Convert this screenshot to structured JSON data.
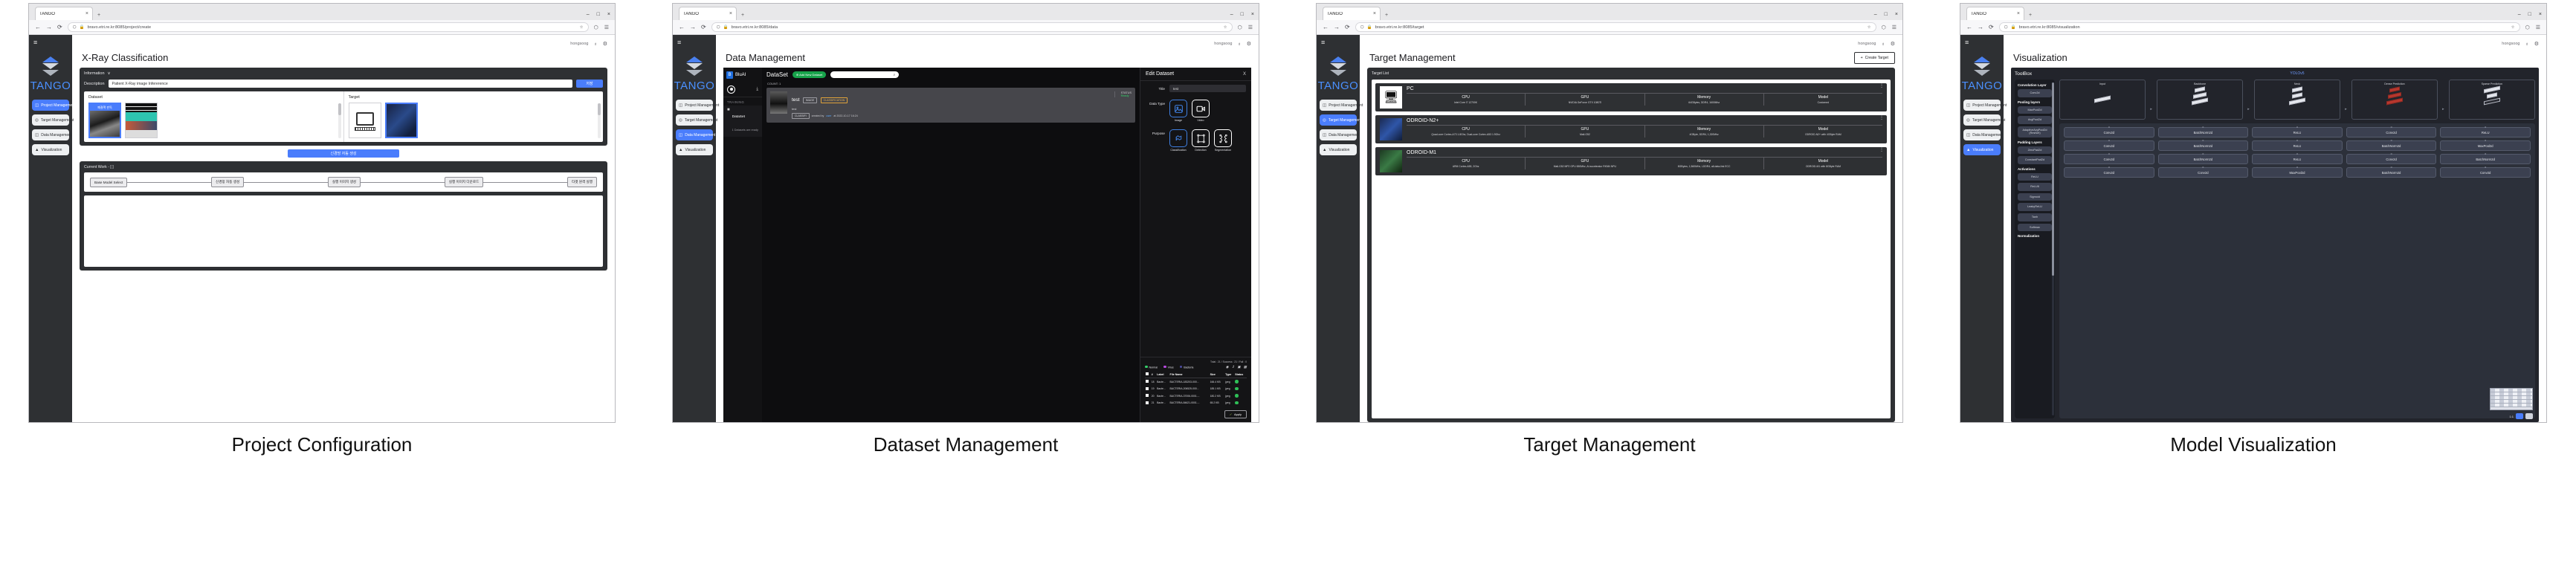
{
  "browser": {
    "tab_title": "TANGO",
    "tab_close": "×",
    "new_tab": "+",
    "minimize": "–",
    "maximize": "□",
    "close": "×",
    "back": "←",
    "forward": "→",
    "reload": "⟳",
    "shield_icon": "⬡",
    "lock_icon": "🔒",
    "star_icon": "☆",
    "pocket_icon": "⬡",
    "menu_icon": "☰"
  },
  "sidebar": {
    "hamburger": "≡",
    "logo_text": "TANGO",
    "items": [
      {
        "label": "Project Management",
        "icon": "project-icon"
      },
      {
        "label": "Target Management",
        "icon": "target-icon"
      },
      {
        "label": "Data Management",
        "icon": "database-icon"
      },
      {
        "label": "Visualization",
        "icon": "chart-icon"
      }
    ]
  },
  "topbar": {
    "user": "hongsoog",
    "bell": "♁",
    "gear": "⚙"
  },
  "panels": [
    {
      "caption": "Project Configuration",
      "url": "bravo.etri.re.kr:8085/project/create",
      "active_nav": 0,
      "page_title": "X-Ray Classification",
      "information": {
        "header": "Information",
        "chevron": "∨",
        "description_label": "Description",
        "description_value": "Patient X-Ray image Infererence",
        "save_label": "저장"
      },
      "dataset": {
        "label": "Dataset",
        "selected_caption": "폐결핵 판독"
      },
      "target": {
        "label": "Target"
      },
      "generate_button": "신경망 자동 생성",
      "current_work": {
        "title": "Current Work -  [    ]",
        "steps": [
          "Base Model Select",
          "신경망 자동 생성",
          "실행 이미지 생성",
          "실행 이미지 다운로드",
          "타겟 원격 실행"
        ]
      }
    },
    {
      "caption": "Dataset Management",
      "url": "bravo.etri.re.kr:8085/data",
      "active_nav": 2,
      "page_title": "Data Management",
      "bluai": {
        "brand": "BluAI",
        "brand_mark": "B",
        "upload_icon": "⤓",
        "section_label": "TRAINING",
        "item_title": "DataSet",
        "item_subtitle": "1 Datasets are ready"
      },
      "dataset_panel": {
        "title": "DataSet",
        "add_button": "⊕ Add New Dataset",
        "search_icon": "⌕",
        "count_label": "COUNT: 1",
        "card": {
          "name": "test",
          "tags": [
            "IMAGE",
            "CLASSIFICATION"
          ],
          "subtitle": "test",
          "status_tag": "CLASSIFI",
          "created_by_label": "created by",
          "created_by": "user",
          "created_at": "at 2022-10-17 16:24",
          "status_col": "STATUS",
          "status_value": "Ready"
        }
      },
      "edit_dataset": {
        "title": "Edit Dataset",
        "close": "X",
        "title_label": "Title",
        "title_value": "test",
        "data_type_label": "Data Type",
        "data_types": [
          {
            "name": "Image",
            "icon": "image-icon"
          },
          {
            "name": "Video",
            "icon": "video-icon"
          }
        ],
        "purpose_label": "Purpose",
        "purposes": [
          {
            "name": "Classification",
            "icon": "classification-icon"
          },
          {
            "name": "Detection",
            "icon": "detection-icon"
          },
          {
            "name": "Segmentation",
            "icon": "segmentation-icon"
          }
        ],
        "totals": "Total : 21  /  Success : 21  /  Fail : 0",
        "legend": [
          {
            "label": "Normal",
            "color": "#35d06a"
          },
          {
            "label": "Virus",
            "color": "#b84ae0"
          },
          {
            "label": "Bacteria",
            "color": "#4a4aa0"
          }
        ],
        "tool_icons": [
          "eye-icon",
          "upload-icon",
          "columns-icon",
          "trash-icon"
        ],
        "columns": [
          "",
          "#",
          "Label",
          "File Name",
          "Size",
          "Type",
          "Status"
        ],
        "rows": [
          {
            "num": "18",
            "label": "Bacte...",
            "file": "BACTERIA-183203-000...",
            "size": "166.4 KB",
            "type": "jpeg"
          },
          {
            "num": "19",
            "label": "Bacte...",
            "file": "BACTERIA-206525-000...",
            "size": "185.1 KB",
            "type": "jpeg"
          },
          {
            "num": "20",
            "label": "Bacte...",
            "file": "BACTERIA-37006-0001....",
            "size": "180.2 KB",
            "type": "jpeg"
          },
          {
            "num": "21",
            "label": "Bacte...",
            "file": "BACTERIA-84621-0001....",
            "size": "65.2 KB",
            "type": "jpeg"
          }
        ],
        "apply_label": "Apply",
        "apply_icon": "check-icon"
      }
    },
    {
      "caption": "Target Management",
      "url": "bravo.etri.re.kr:8085/target",
      "active_nav": 1,
      "page_title": "Target Management",
      "create_button": "Create Target",
      "create_icon": "+",
      "target_list_label": "Target List",
      "spec_headers": [
        "CPU",
        "GPU",
        "Memory",
        "Model"
      ],
      "targets": [
        {
          "name": "PC",
          "image": "desktop-pc-icon",
          "cpu": "Intel Core i7 12700K",
          "gpu": "NVIDIA GeForce GTX 1080Ti",
          "memory": "64GBytes, DDR4, 1600Mhz",
          "model": "Customed"
        },
        {
          "name": "ODROID-N2+",
          "image": "odroid-n2-board",
          "cpu": "Quad-core Cortex-A73 1.8Ghz, Dual-core Cortex-A53 1.9Ghz",
          "gpu": "Mali-G52",
          "memory": "4GByte, DDR4, 1,320Mhz",
          "model": "ODROID-N2+ with 4GByte RAM"
        },
        {
          "name": "ODROID-M1",
          "image": "odroid-m1-board",
          "cpu": "ARM Cortex-A55, 2Ghz",
          "gpu": "Mali-G52 MP2 GPU 650Mhz, AI accelerator RKNN NPU",
          "memory": "8GBytes, 1,560MHz, LDDR4, all-data-link ECC",
          "model": "ODROID-M1 with 8GByte RAM"
        }
      ]
    },
    {
      "caption": "Model Visualization",
      "url": "bravo.etri.re.kr:8085/visualization",
      "active_nav": 3,
      "page_title": "Visualization",
      "toolbox": {
        "title": "ToolBox",
        "groups": [
          {
            "group": "Convolution Layer",
            "chips": [
              "Conv2d"
            ]
          },
          {
            "group": "Pooling layers",
            "chips": [
              "MaxPool2d",
              "AvgPool2d",
              "AdaptiveAvgPool2d (ResNet)"
            ]
          },
          {
            "group": "Padding Layers",
            "chips": [
              "ZeroPad2d",
              "ConstantPad2d"
            ]
          },
          {
            "group": "Activations",
            "chips": [
              "ReLU",
              "ReLU6",
              "Sigmoid",
              "LeakyReLU",
              "Tanh",
              "Softmax"
            ]
          },
          {
            "group": "Normalization",
            "chips": []
          }
        ]
      },
      "canvas": {
        "model_name": "YOLOv5",
        "stages": [
          "Input",
          "Backbone",
          "Neck",
          "Dense Prediction",
          "Sparse Prediction"
        ],
        "arrow": "▸",
        "layer_grid": [
          [
            "Conv2d",
            "BatchNorm2d",
            "ReLU",
            "Conv2d",
            "ReLU"
          ],
          [
            "Conv2d",
            "BatchNorm2d",
            "ReLU",
            "BatchNorm2d",
            "MaxPool2d"
          ],
          [
            "Conv2d",
            "BatchNorm2d",
            "ReLU",
            "Conv2d",
            "BatchNorm2d"
          ],
          [
            "Conv2d",
            "Conv2d",
            "MaxPool2d",
            "BatchNorm2d",
            "Conv2d"
          ]
        ],
        "zoom_value": "1:1",
        "zoom_in": "+",
        "zoom_out": "−"
      }
    }
  ]
}
